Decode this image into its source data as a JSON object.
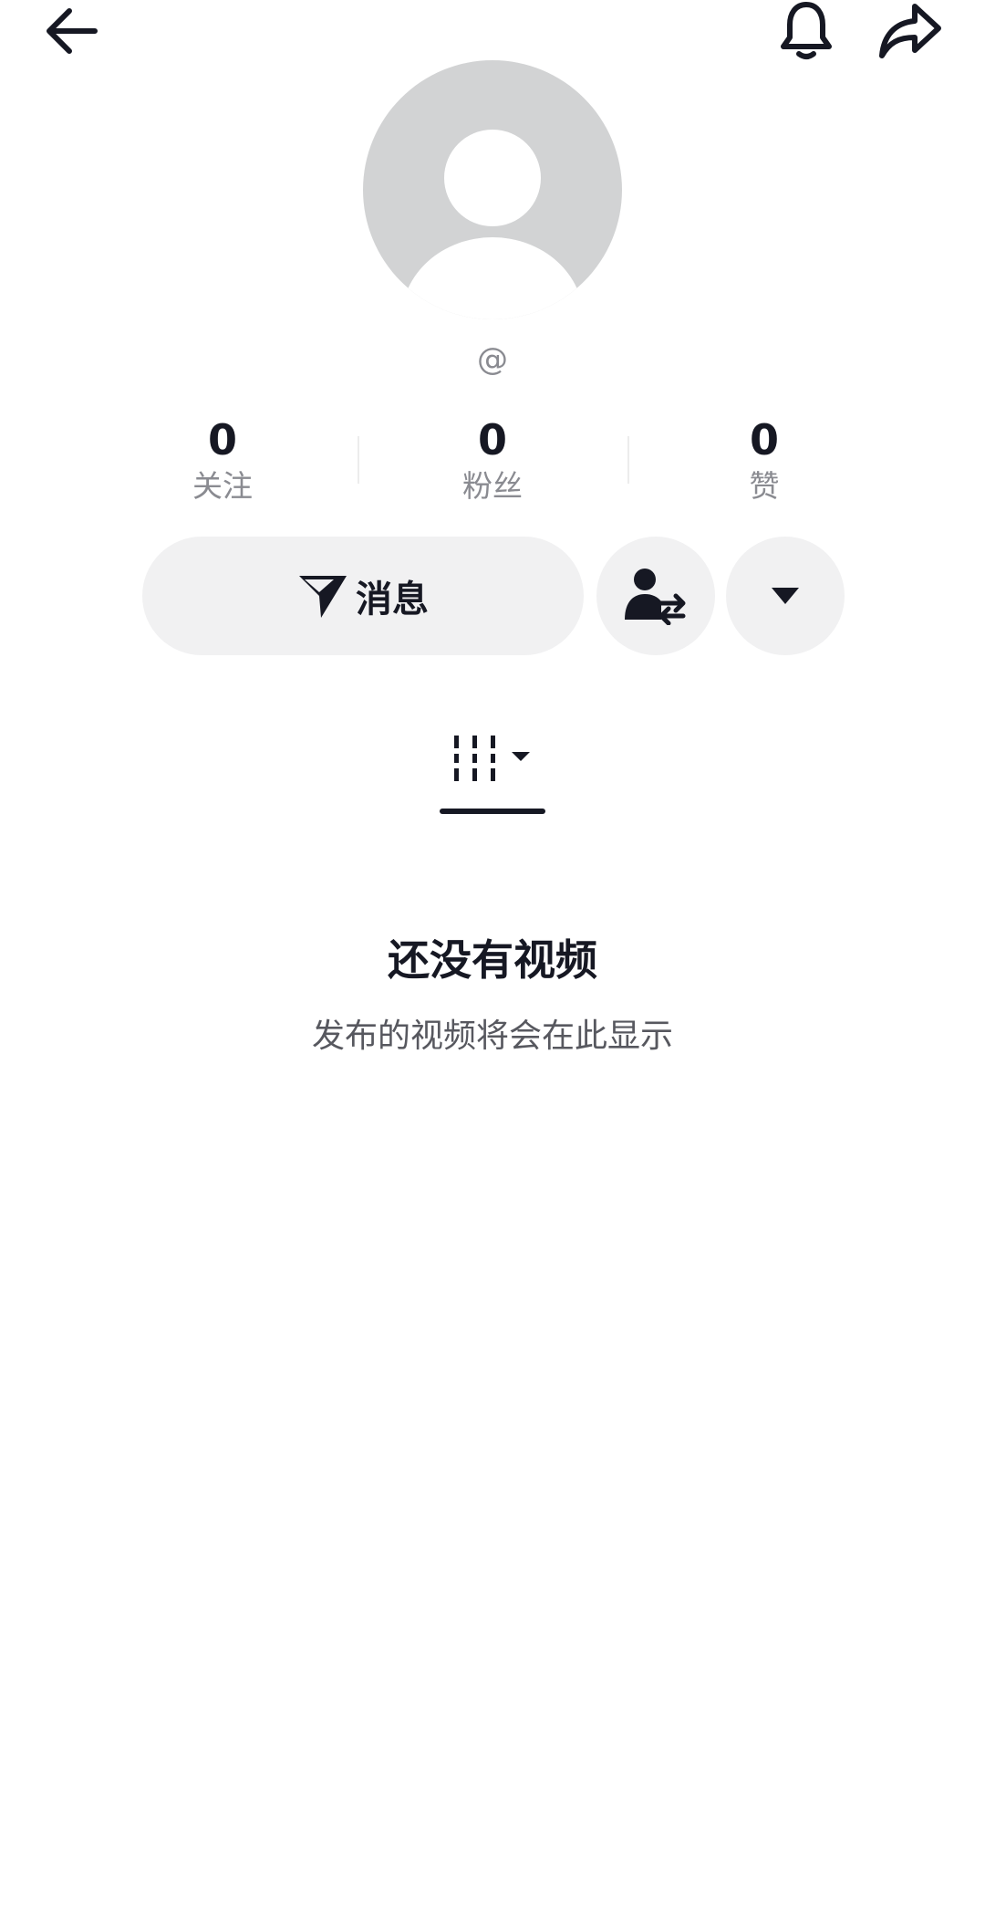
{
  "header": {
    "back_icon": "arrow-left-icon",
    "bell_icon": "bell-icon",
    "share_icon": "share-arrow-icon"
  },
  "profile": {
    "avatar_icon": "default-avatar-icon",
    "handle": "@"
  },
  "stats": [
    {
      "value": "0",
      "label": "关注"
    },
    {
      "value": "0",
      "label": "粉丝"
    },
    {
      "value": "0",
      "label": "赞"
    }
  ],
  "actions": {
    "message_label": "消息",
    "message_icon": "paper-plane-icon",
    "switch_icon": "user-swap-icon",
    "more_icon": "caret-down-icon"
  },
  "tabs": {
    "videos_icon": "video-grid-icon"
  },
  "empty_state": {
    "title": "还没有视频",
    "subtitle": "发布的视频将会在此显示"
  },
  "colors": {
    "text_primary": "#161823",
    "text_secondary": "#8a8b91",
    "button_bg": "#f1f1f2",
    "avatar_bg": "#d2d3d4"
  }
}
